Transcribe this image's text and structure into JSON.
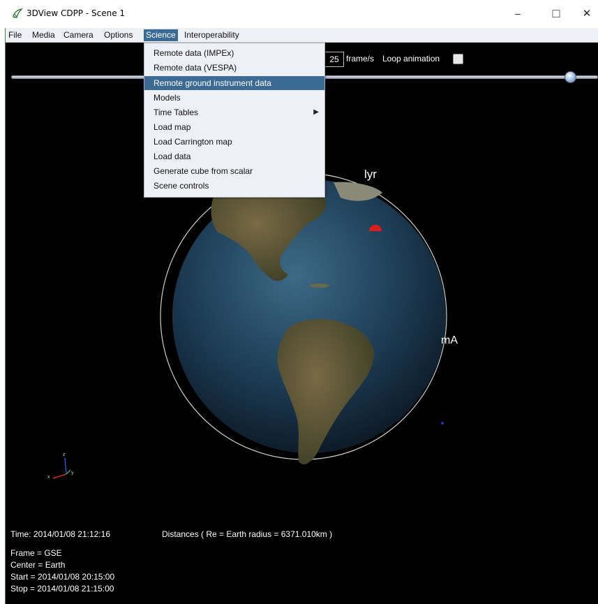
{
  "window": {
    "title": "3DView CDPP - Scene 1",
    "minimize_glyph": "–",
    "maximize_glyph": "□",
    "close_glyph": "✕"
  },
  "menubar": {
    "items": [
      "File",
      "Media",
      "Camera",
      "Options",
      "Science",
      "Interoperability"
    ]
  },
  "animation": {
    "fps_value": "25",
    "fps_label": "frame/s",
    "loop_label": "Loop animation",
    "loop_checked": false,
    "timeline_progress": 0.95
  },
  "science_menu": {
    "items": [
      "Remote data (IMPEx)",
      "Remote data (VESPA)",
      "Remote ground instrument data",
      "Models",
      "Time Tables",
      "Load map",
      "Load Carrington map",
      "Load data",
      "Generate cube from scalar",
      "Scene controls"
    ],
    "highlighted_index": 2,
    "submenu_index": 4,
    "submenu_arrow": "▶"
  },
  "scene": {
    "station_labels": [
      "lyr",
      "mA"
    ],
    "axes_labels": [
      "z",
      "y",
      "x"
    ]
  },
  "info": {
    "time": "Time: 2014/01/08 21:12:16",
    "distances": "Distances ( Re = Earth radius = 6371.010km )",
    "frame": "Frame = GSE",
    "center": "Center = Earth",
    "start": "Start = 2014/01/08 20:15:00",
    "stop": "Stop = 2014/01/08 21:15:00"
  },
  "colors": {
    "menu_highlight": "#3b6b95",
    "menu_background": "#eef0f5",
    "station_marker": "#e01b1b"
  }
}
